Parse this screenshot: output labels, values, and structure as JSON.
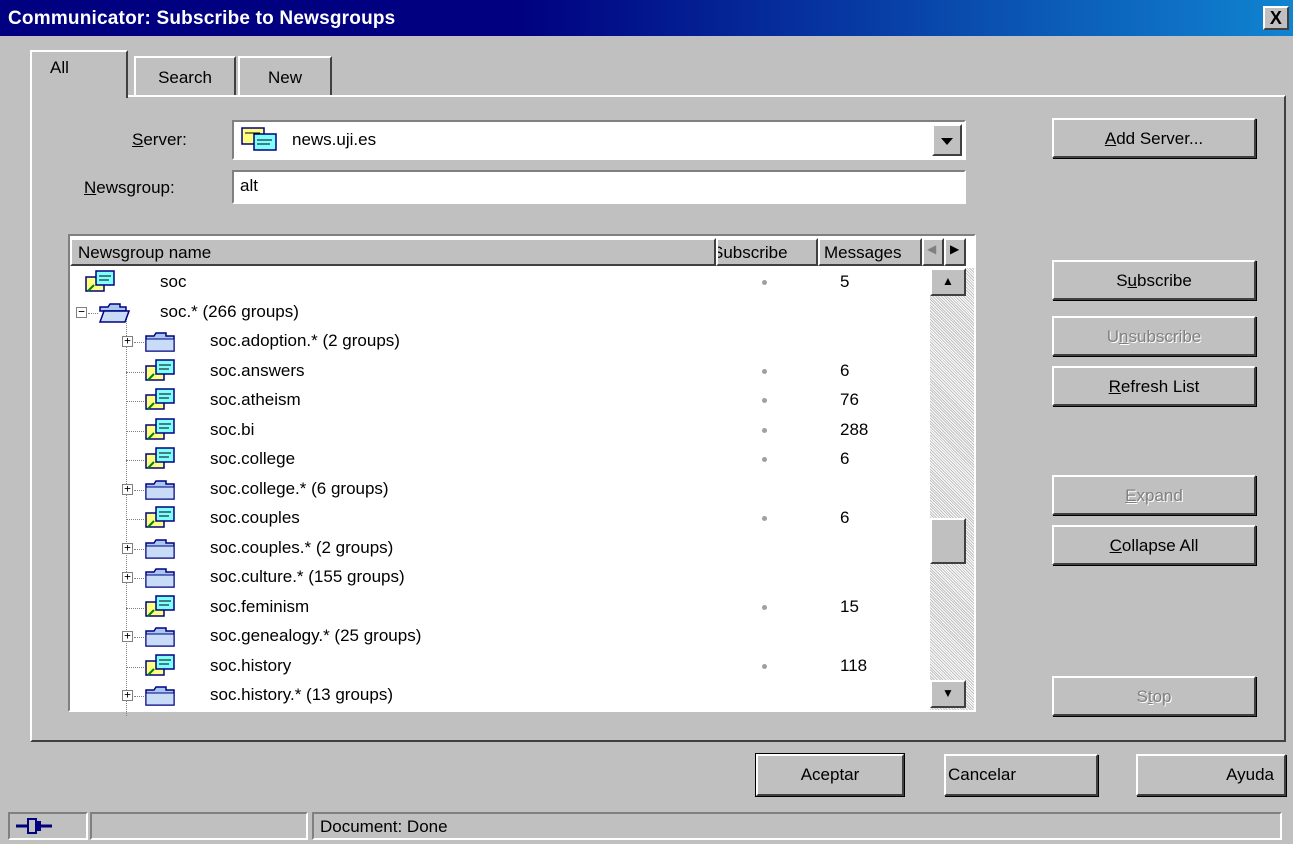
{
  "window": {
    "title": "Communicator: Subscribe to Newsgroups",
    "close_glyph": "X"
  },
  "tabs": [
    {
      "label": "All"
    },
    {
      "label": "Search"
    },
    {
      "label": "New"
    }
  ],
  "form": {
    "server_label": "Server:",
    "server_value": "news.uji.es",
    "newsgroup_label": "Newsgroup:",
    "newsgroup_value": "alt"
  },
  "list": {
    "columns": [
      "Newsgroup name",
      "Subscribe",
      "Messages"
    ],
    "rows": [
      {
        "name": "soc",
        "type": "group",
        "level": 0,
        "messages": "5"
      },
      {
        "name": "soc.* (266 groups)",
        "type": "folder",
        "level": 0,
        "expanded": true
      },
      {
        "name": "soc.adoption.* (2 groups)",
        "type": "folder",
        "level": 1
      },
      {
        "name": "soc.answers",
        "type": "group",
        "level": 1,
        "messages": "6"
      },
      {
        "name": "soc.atheism",
        "type": "group",
        "level": 1,
        "messages": "76"
      },
      {
        "name": "soc.bi",
        "type": "group",
        "level": 1,
        "messages": "288"
      },
      {
        "name": "soc.college",
        "type": "group",
        "level": 1,
        "messages": "6"
      },
      {
        "name": "soc.college.* (6 groups)",
        "type": "folder",
        "level": 1
      },
      {
        "name": "soc.couples",
        "type": "group",
        "level": 1,
        "messages": "6"
      },
      {
        "name": "soc.couples.* (2 groups)",
        "type": "folder",
        "level": 1
      },
      {
        "name": "soc.culture.* (155 groups)",
        "type": "folder",
        "level": 1
      },
      {
        "name": "soc.feminism",
        "type": "group",
        "level": 1,
        "messages": "15"
      },
      {
        "name": "soc.genealogy.* (25 groups)",
        "type": "folder",
        "level": 1
      },
      {
        "name": "soc.history",
        "type": "group",
        "level": 1,
        "messages": "118"
      },
      {
        "name": "soc.history.* (13 groups)",
        "type": "folder",
        "level": 1
      }
    ]
  },
  "side_buttons": {
    "add_server": "Add Server...",
    "subscribe": "Subscribe",
    "unsubscribe": "Unsubscribe",
    "refresh": "Refresh List",
    "expand": "Expand",
    "collapse_all": "Collapse All",
    "stop": "Stop"
  },
  "footer_buttons": {
    "ok": "Aceptar",
    "cancel": "Cancelar",
    "help": "Ayuda"
  },
  "status": {
    "text": "Document: Done"
  }
}
